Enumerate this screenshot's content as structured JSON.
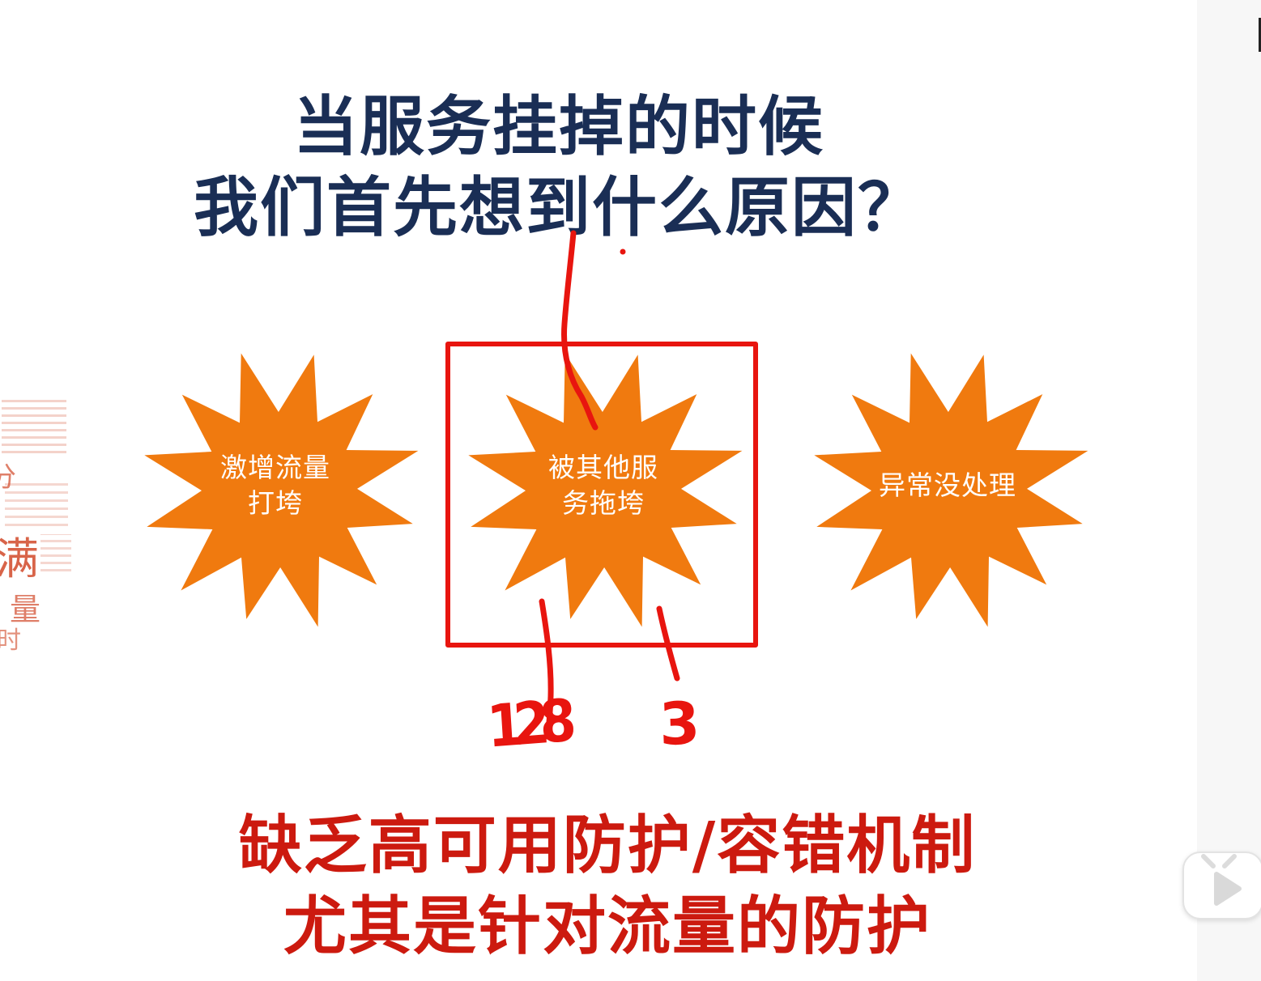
{
  "colors": {
    "title": "#1a2e55",
    "caption": "#cc1a0f",
    "burst": "#f07a0f",
    "annotation": "#e8150f"
  },
  "title": {
    "line1": "当服务挂掉的时候",
    "line2": "我们首先想到什么原因？"
  },
  "bursts": [
    {
      "line1": "激增流量",
      "line2": "打垮"
    },
    {
      "line1": "被其他服",
      "line2": "务拖垮"
    },
    {
      "line1": "异常没处理",
      "line2": ""
    }
  ],
  "annotations": {
    "number_left": "128",
    "number_right": "3"
  },
  "caption": {
    "line1": "缺乏高可用防护/容错机制",
    "line2": "尤其是针对流量的防护"
  },
  "wordcloud": {
    "chars": [
      "满",
      "量",
      "时",
      "分"
    ]
  },
  "player": {
    "play_icon": "play-icon"
  }
}
